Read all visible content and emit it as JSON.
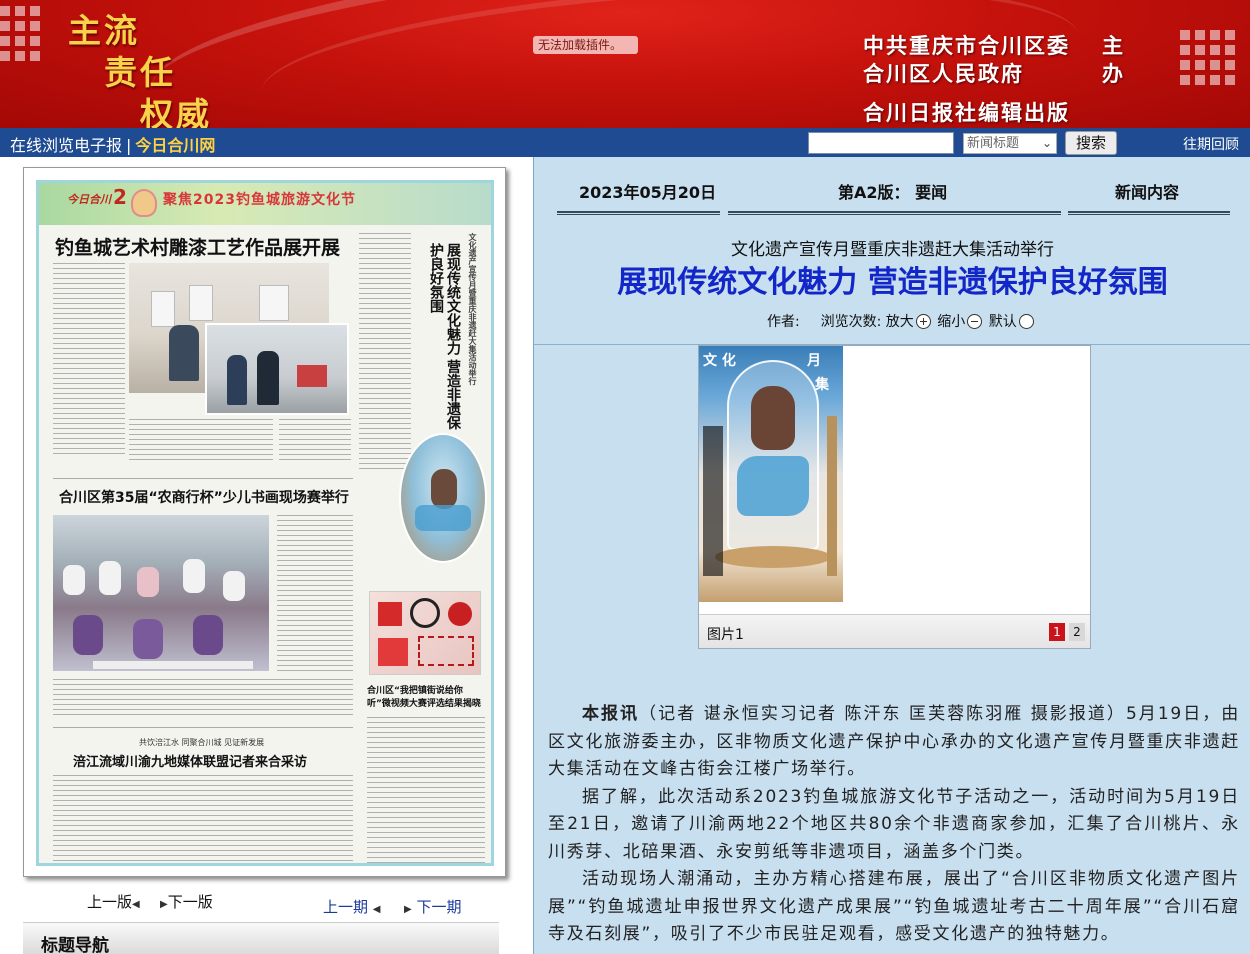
{
  "banner": {
    "slogans": [
      "主流",
      "责任",
      "权威"
    ],
    "notice": "无法加载插件。",
    "org_line1": "中共重庆市合川区委",
    "org_line2": "合川区人民政府",
    "org_role1": "主",
    "org_role2": "办",
    "publisher": "合川日报社编辑出版",
    "colors": {
      "red": "#c4110b",
      "gold": "#f7d24a"
    }
  },
  "nav": {
    "browse_label": "在线浏览电子报",
    "separator": "|",
    "site_link": "今日合川网",
    "search_placeholder": "",
    "search_select": "新闻标题",
    "search_button": "搜索",
    "archive_link": "往期回顾"
  },
  "page_thumb": {
    "paper_logo": "今日合川",
    "page_number": "2",
    "focus_banner": "聚焦2023钓鱼城旅游文化节",
    "story1_title": "钓鱼城艺术村雕漆工艺作品展开展",
    "story2_title": "合川区第35届“农商行杯”少儿书画现场赛举行",
    "story3_kicker": "共饮涪江水 同聚合川城 见证新发展",
    "story3_title": "涪江流域川渝九地媒体联盟记者来合采访",
    "vertical_title": "展现传统文化魅力 营造非遗保护良好氛围",
    "vertical_kicker": "文化遗产宣传月暨重庆非遗赶大集活动举行",
    "side_story_title": "合川区“我把镇街说给你听”微视频大赛评选结果揭晓"
  },
  "pager": {
    "prev_page": "上一版",
    "next_page": "下一版",
    "prev_issue": "上一期",
    "next_issue": "下一期"
  },
  "sidebar": {
    "nav_title": "标题导航"
  },
  "meta": {
    "date": "2023年05月20日",
    "edition": "第A2版：  要闻",
    "section": "新闻内容"
  },
  "article": {
    "subhead": "文化遗产宣传月暨重庆非遗赶大集活动举行",
    "headline": "展现传统文化魅力 营造非遗保护良好氛围",
    "author_label": "作者:",
    "views_label": "浏览次数:",
    "zoom_in": "放大",
    "zoom_out": "缩小",
    "zoom_default": "默认",
    "image_caption": "图片1",
    "image_pages": [
      "1",
      "2"
    ],
    "lead": "本报讯",
    "p1_rest": "（记者  谌永恒实习记者  陈汗东  匡芙蓉陈羽雁  摄影报道）5月19日，由区文化旅游委主办，区非物质文化遗产保护中心承办的文化遗产宣传月暨重庆非遗赶大集活动在文峰古街会江楼广场举行。",
    "p2": "据了解，此次活动系2023钓鱼城旅游文化节子活动之一，活动时间为5月19日至21日，邀请了川渝两地22个地区共80余个非遗商家参加，汇集了合川桃片、永川秀芽、北碚果酒、永安剪纸等非遗项目，涵盖多个门类。",
    "p3": "活动现场人潮涌动，主办方精心搭建布展，展出了“合川区非物质文化遗产图片展”“钓鱼城遗址申报世界文化遗产成果展”“钓鱼城遗址考古二十周年展”“合川石窟寺及石刻展”，吸引了不少市民驻足观看，感受文化遗产的独特魅力。"
  }
}
